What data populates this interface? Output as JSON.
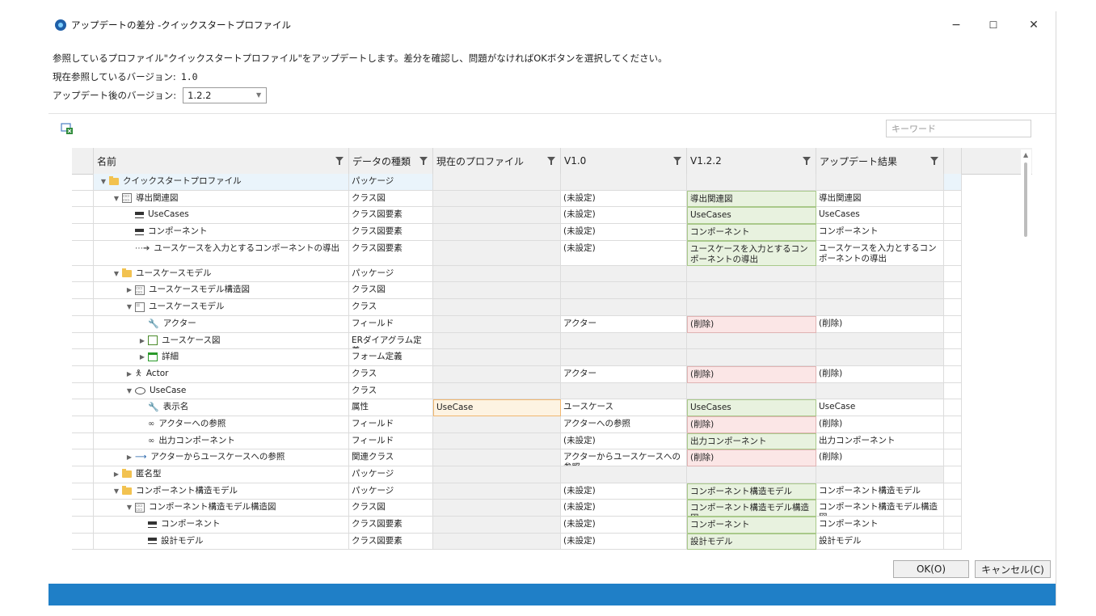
{
  "window": {
    "title": "アップデートの差分 -クイックスタートプロファイル"
  },
  "controls": {
    "minimize": "−",
    "maximize": "☐",
    "close": "✕"
  },
  "info": {
    "message": "参照しているプロファイル\"クイックスタートプロファイル\"をアップデートします。差分を確認し、問題がなければOKボタンを選択してください。",
    "current_label": "現在参照しているバージョン:",
    "current_value": "1.0",
    "new_label": "アップデート後のバージョン:",
    "new_value": "1.2.2"
  },
  "toolbar": {
    "search_placeholder": "キーワード"
  },
  "columns": [
    "名前",
    "データの種類",
    "現在のプロファイル",
    "V1.0",
    "V1.2.2",
    "アップデート結果"
  ],
  "rows": [
    {
      "name": "クイックスタートプロファイル",
      "type": "パッケージ",
      "cur": "",
      "v10": "",
      "v122": "",
      "res": "",
      "indent": 0,
      "tw": "▼",
      "icon": "folder",
      "style": "sel"
    },
    {
      "name": "導出関連図",
      "type": "クラス図",
      "cur": "",
      "v10": "(未設定)",
      "v122": "導出関連図",
      "res": "導出関連図",
      "indent": 1,
      "tw": "▼",
      "icon": "diagram",
      "style": "green"
    },
    {
      "name": "UseCases",
      "type": "クラス図要素",
      "cur": "",
      "v10": "(未設定)",
      "v122": "UseCases",
      "res": "UseCases",
      "indent": 2,
      "tw": "",
      "icon": "class-element",
      "style": "green"
    },
    {
      "name": "コンポーネント",
      "type": "クラス図要素",
      "cur": "",
      "v10": "(未設定)",
      "v122": "コンポーネント",
      "res": "コンポーネント",
      "indent": 2,
      "tw": "",
      "icon": "class-element",
      "style": "green"
    },
    {
      "name": "ユースケースを入力とするコンポーネントの導出",
      "type": "クラス図要素",
      "cur": "",
      "v10": "(未設定)",
      "v122": "ユースケースを入力とするコンポーネントの導出",
      "res": "ユースケースを入力とするコンポーネントの導出",
      "indent": 2,
      "tw": "",
      "icon": "dependency",
      "style": "green",
      "tall": true
    },
    {
      "name": "ユースケースモデル",
      "type": "パッケージ",
      "cur": "",
      "v10": "",
      "v122": "",
      "res": "",
      "indent": 1,
      "tw": "▼",
      "icon": "folder",
      "style": "gray"
    },
    {
      "name": "ユースケースモデル構造図",
      "type": "クラス図",
      "cur": "",
      "v10": "",
      "v122": "",
      "res": "",
      "indent": 2,
      "tw": "▶",
      "icon": "diagram",
      "style": "gray"
    },
    {
      "name": "ユースケースモデル",
      "type": "クラス",
      "cur": "",
      "v10": "",
      "v122": "",
      "res": "",
      "indent": 2,
      "tw": "▼",
      "icon": "class",
      "style": "gray"
    },
    {
      "name": "アクター",
      "type": "フィールド",
      "cur": "",
      "v10": "アクター",
      "v122": "(削除)",
      "res": "(削除)",
      "indent": 3,
      "tw": "",
      "icon": "wrench",
      "style": "red"
    },
    {
      "name": "ユースケース図",
      "type": "ERダイアグラム定義",
      "cur": "",
      "v10": "",
      "v122": "",
      "res": "",
      "indent": 3,
      "tw": "▶",
      "icon": "er",
      "style": "gray"
    },
    {
      "name": "詳細",
      "type": "フォーム定義",
      "cur": "",
      "v10": "",
      "v122": "",
      "res": "",
      "indent": 3,
      "tw": "▶",
      "icon": "form",
      "style": "gray"
    },
    {
      "name": "Actor",
      "type": "クラス",
      "cur": "",
      "v10": "アクター",
      "v122": "(削除)",
      "res": "(削除)",
      "indent": 2,
      "tw": "▶",
      "icon": "actor",
      "style": "red"
    },
    {
      "name": "UseCase",
      "type": "クラス",
      "cur": "",
      "v10": "",
      "v122": "",
      "res": "",
      "indent": 2,
      "tw": "▼",
      "icon": "oval",
      "style": "gray"
    },
    {
      "name": "表示名",
      "type": "属性",
      "cur": "UseCase",
      "v10": "ユースケース",
      "v122": "UseCases",
      "res": "UseCase",
      "indent": 3,
      "tw": "",
      "icon": "wrench-blue",
      "style": "orange"
    },
    {
      "name": "アクターへの参照",
      "type": "フィールド",
      "cur": "",
      "v10": "アクターへの参照",
      "v122": "(削除)",
      "res": "(削除)",
      "indent": 3,
      "tw": "",
      "icon": "link",
      "style": "red"
    },
    {
      "name": "出力コンポーネント",
      "type": "フィールド",
      "cur": "",
      "v10": "(未設定)",
      "v122": "出力コンポーネント",
      "res": "出力コンポーネント",
      "indent": 3,
      "tw": "",
      "icon": "link",
      "style": "green"
    },
    {
      "name": "アクターからユースケースへの参照",
      "type": "関連クラス",
      "cur": "",
      "v10": "アクターからユースケースへの参照",
      "v122": "(削除)",
      "res": "(削除)",
      "indent": 2,
      "tw": "▶",
      "icon": "arrow",
      "style": "red"
    },
    {
      "name": "匿名型",
      "type": "パッケージ",
      "cur": "",
      "v10": "",
      "v122": "",
      "res": "",
      "indent": 1,
      "tw": "▶",
      "icon": "folder",
      "style": "gray"
    },
    {
      "name": "コンポーネント構造モデル",
      "type": "パッケージ",
      "cur": "",
      "v10": "(未設定)",
      "v122": "コンポーネント構造モデル",
      "res": "コンポーネント構造モデル",
      "indent": 1,
      "tw": "▼",
      "icon": "folder",
      "style": "green"
    },
    {
      "name": "コンポーネント構造モデル構造図",
      "type": "クラス図",
      "cur": "",
      "v10": "(未設定)",
      "v122": "コンポーネント構造モデル構造図",
      "res": "コンポーネント構造モデル構造図",
      "indent": 2,
      "tw": "▼",
      "icon": "diagram",
      "style": "green"
    },
    {
      "name": "コンポーネント",
      "type": "クラス図要素",
      "cur": "",
      "v10": "(未設定)",
      "v122": "コンポーネント",
      "res": "コンポーネント",
      "indent": 3,
      "tw": "",
      "icon": "class-element",
      "style": "green"
    },
    {
      "name": "設計モデル",
      "type": "クラス図要素",
      "cur": "",
      "v10": "(未設定)",
      "v122": "設計モデル",
      "res": "設計モデル",
      "indent": 3,
      "tw": "",
      "icon": "class-element",
      "style": "green"
    }
  ],
  "buttons": {
    "ok": "OK(O)",
    "cancel": "キャンセル(C)"
  }
}
